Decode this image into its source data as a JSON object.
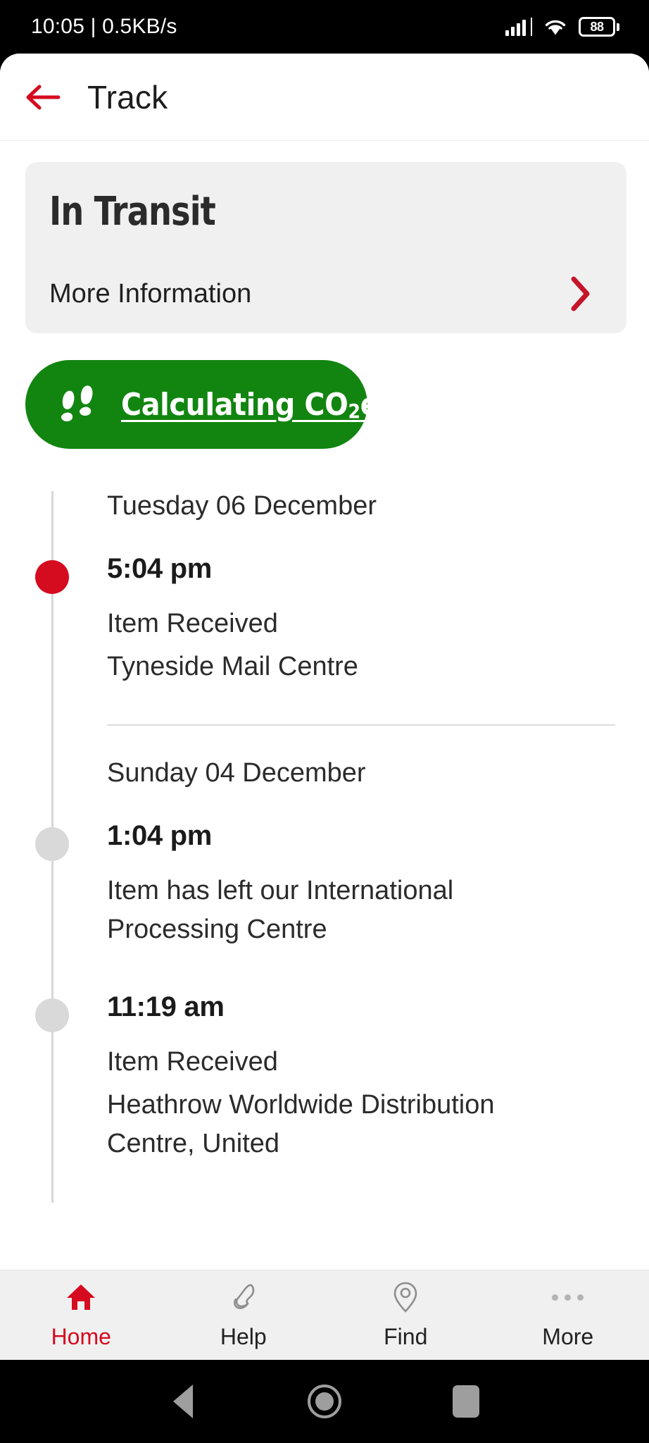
{
  "statusbar": {
    "clock_and_speed": "10:05 | 0.5KB/s",
    "battery_level": "88",
    "signal_icon": "signal-bars-icon",
    "wifi_icon": "wifi-icon",
    "battery_icon": "battery-icon"
  },
  "appbar": {
    "back_icon": "back-arrow-icon",
    "title": "Track"
  },
  "status_card": {
    "status": "In Transit",
    "more_label": "More Information",
    "chevron_icon": "chevron-right-icon",
    "background": "#f0f0f0"
  },
  "co2_button": {
    "icon": "footprints-icon",
    "label_prefix": "Calculating CO",
    "label_sub": "2",
    "label_suffix": "e",
    "color": "#118510"
  },
  "timeline": {
    "accent_color": "#d50b1f",
    "inactive_color": "#d9d9d9",
    "groups": [
      {
        "date": "Tuesday 06 December",
        "entries": [
          {
            "time": "5:04 pm",
            "active": true,
            "lines": [
              "Item Received",
              "Tyneside Mail Centre"
            ]
          }
        ]
      },
      {
        "date": "Sunday 04 December",
        "entries": [
          {
            "time": "1:04 pm",
            "active": false,
            "lines": [
              "Item has left our International Processing Centre"
            ]
          },
          {
            "time": "11:19 am",
            "active": false,
            "lines": [
              "Item Received",
              "Heathrow Worldwide Distribution Centre, United"
            ]
          }
        ]
      }
    ]
  },
  "bottomnav": {
    "items": [
      {
        "label": "Home",
        "icon": "home-icon",
        "active": true
      },
      {
        "label": "Help",
        "icon": "phone-icon",
        "active": false
      },
      {
        "label": "Find",
        "icon": "location-pin-icon",
        "active": false
      },
      {
        "label": "More",
        "icon": "three-dots-icon",
        "active": false
      }
    ]
  },
  "androidnav": {
    "back_icon": "android-back-icon",
    "home_icon": "android-home-icon",
    "recents_icon": "android-recents-icon"
  }
}
